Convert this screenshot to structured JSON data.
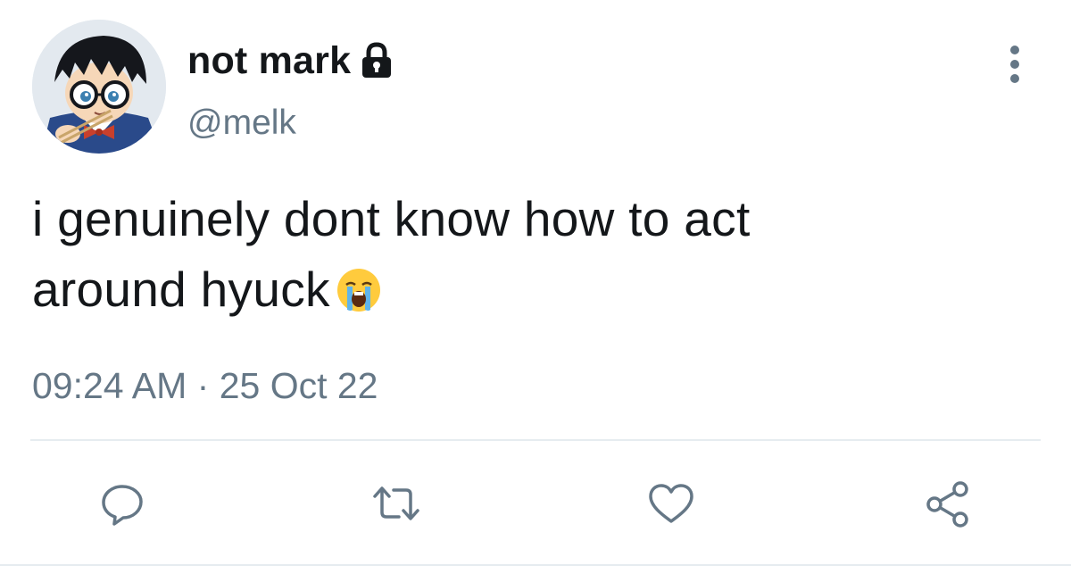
{
  "author": {
    "display_name": "not mark",
    "handle": "@melk",
    "avatar_icon": "anime-avatar-icon",
    "protected_icon": "lock-icon"
  },
  "tweet": {
    "text_line1": "i genuinely dont know how to act",
    "text_line2": "around hyuck",
    "emoji": "loudly-crying-face-emoji",
    "time": "09:24 AM",
    "separator": "·",
    "date": "25 Oct 22"
  },
  "actions": {
    "reply_icon": "reply-icon",
    "retweet_icon": "retweet-icon",
    "like_icon": "heart-icon",
    "share_icon": "share-icon"
  },
  "colors": {
    "text": "#14171a",
    "secondary": "#657786",
    "divider": "#e6ecf0"
  }
}
